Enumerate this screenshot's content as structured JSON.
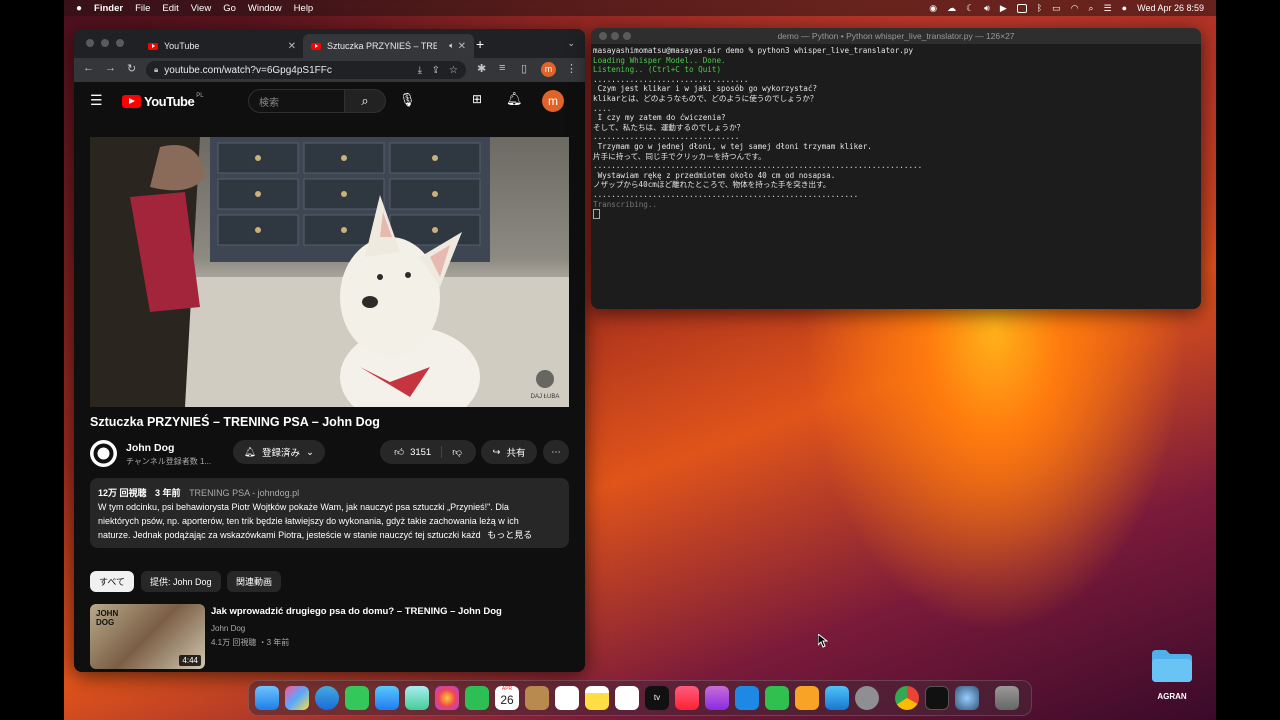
{
  "menubar": {
    "app": "Finder",
    "items": [
      "File",
      "Edit",
      "View",
      "Go",
      "Window",
      "Help"
    ],
    "clock": "Wed Apr 26  8:59"
  },
  "browser": {
    "tabs": [
      {
        "label": "YouTube"
      },
      {
        "label": "Sztuczka PRZYNIEŚ – TRE"
      }
    ],
    "url": "youtube.com/watch?v=6Gpg4pS1FFc",
    "profile_initial": "m"
  },
  "youtube": {
    "logo_text": "YouTube",
    "logo_region": "PL",
    "search_placeholder": "検索",
    "video_title": "Sztuczka PRZYNIEŚ – TRENING PSA – John Dog",
    "watermark": "DAJ ŁUBA",
    "channel_name": "John Dog",
    "subscribers": "チャンネル登録者数 1...",
    "subscribed_label": "登録済み",
    "likes": "3151",
    "share_label": "共有",
    "description": {
      "views": "12万 回視聴",
      "age": "3 年前",
      "tags": "TRENING PSA - johndog.pl",
      "line1": "W tym odcinku, psi behawiorysta Piotr Wojtków pokaże Wam, jak nauczyć psa sztuczki „Przynieś!\". Dla",
      "line2": "niektórych psów, np. aporterów, ten trik będzie łatwiejszy do wykonania, gdyż takie zachowania leżą w ich",
      "line3": "naturze. Jednak podążając za wskazówkami Piotra, jesteście w stanie nauczyć tej sztuczki każd",
      "more": "もっと見る"
    },
    "chips": [
      "すべて",
      "提供: John Dog",
      "関連動画"
    ],
    "recommended": {
      "title": "Jak wprowadzić drugiego psa do domu? – TRENING – John Dog",
      "channel": "John Dog",
      "meta": "4.1万 回視聴 ・3 年前",
      "duration": "4:44",
      "thumb_text": "JOHN DOG"
    }
  },
  "terminal": {
    "title": "demo — Python • Python whisper_live_translator.py — 126×27",
    "lines": [
      {
        "t": "masayashimomatsu@masayas-air demo % python3 whisper_live_translator.py",
        "c": ""
      },
      {
        "t": "Loading Whisper Model.. Done.",
        "c": "g"
      },
      {
        "t": "Listening.. (Ctrl+C to Quit)",
        "c": "g"
      },
      {
        "t": "..................................",
        "c": ""
      },
      {
        "t": " Czym jest klikar i w jaki sposób go wykorzystać?",
        "c": ""
      },
      {
        "t": "klikarとは、どのようなもので、どのように使うのでしょうか？",
        "c": ""
      },
      {
        "t": "....",
        "c": ""
      },
      {
        "t": " I czy my zatem do ćwiczenia?",
        "c": ""
      },
      {
        "t": "そして、私たちは、運動するのでしょうか？",
        "c": ""
      },
      {
        "t": "................................",
        "c": ""
      },
      {
        "t": " Trzymam go w jednej dłoni, w tej samej dłoni trzymam kliker.",
        "c": ""
      },
      {
        "t": "片手に持って、同じ手でクリッカーを持つんです。",
        "c": ""
      },
      {
        "t": "........................................................................",
        "c": ""
      },
      {
        "t": " Wystawiam rękę z przedmiotem około 40 cm od nosapsa.",
        "c": ""
      },
      {
        "t": "ノザップから40cmほど離れたところで、物体を持った手を突き出す。",
        "c": ""
      },
      {
        "t": "..........................................................",
        "c": ""
      },
      {
        "t": "Transcribing..",
        "c": "d"
      }
    ]
  },
  "dock": {
    "calendar_month": "APR",
    "calendar_day": "26",
    "tv_label": "tv"
  },
  "desktop": {
    "folder_label": "AGRAN"
  }
}
